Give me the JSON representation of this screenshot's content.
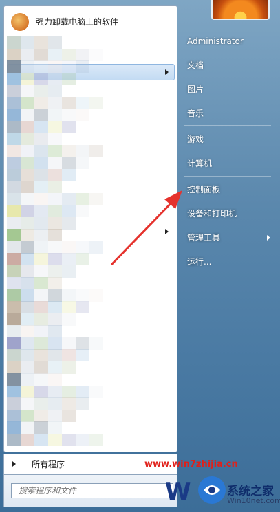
{
  "start_menu": {
    "pinned_program": "强力卸载电脑上的软件",
    "all_programs_label": "所有程序",
    "search_placeholder": "搜索程序和文件"
  },
  "user": {
    "name": "Administrator"
  },
  "right_menu": [
    {
      "label": "文档"
    },
    {
      "label": "图片"
    },
    {
      "label": "音乐"
    },
    {
      "label": "游戏"
    },
    {
      "label": "计算机"
    },
    {
      "label": "控制面板"
    },
    {
      "label": "设备和打印机"
    },
    {
      "label": "管理工具"
    },
    {
      "label": "运行..."
    }
  ],
  "watermark": {
    "site": "www.win7zhijia.cn",
    "brand": "系统之家",
    "sub": "Win10net.com"
  },
  "colors": {
    "annotation_arrow": "#e5322d",
    "right_panel": "#5b88ad"
  }
}
